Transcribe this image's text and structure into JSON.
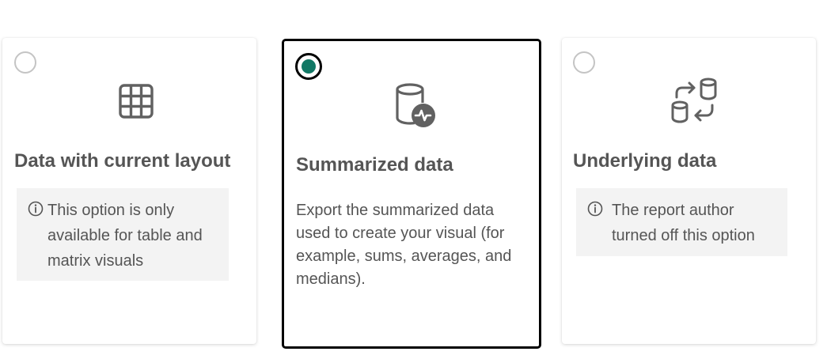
{
  "options": [
    {
      "title": "Data with current layout",
      "info": "This option is only available for table and matrix visuals",
      "selected": false,
      "icon": "table-grid-icon"
    },
    {
      "title": "Summarized data",
      "description": "Export the summarized data used to create your visual (for example, sums, averages, and medians).",
      "selected": true,
      "icon": "database-pulse-icon"
    },
    {
      "title": "Underlying data",
      "info": "The report author turned off this option",
      "selected": false,
      "icon": "database-swap-icon"
    }
  ],
  "colors": {
    "selected_radio": "#117865",
    "text": "#555555",
    "info_background": "#f3f3f3"
  }
}
